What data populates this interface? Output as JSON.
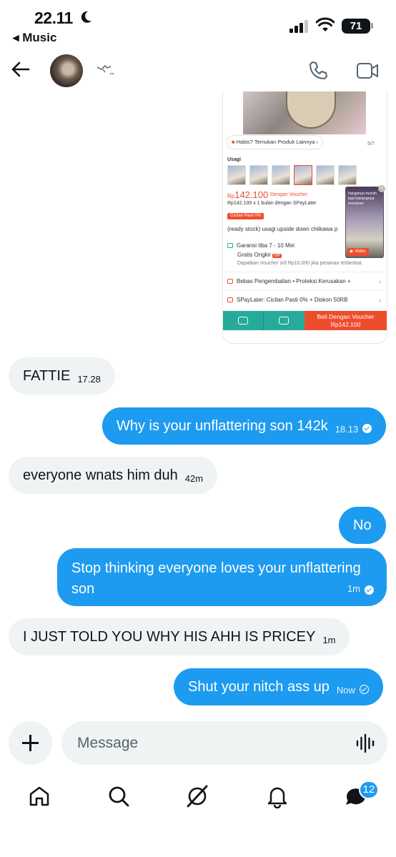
{
  "status_bar": {
    "time": "22.11",
    "back_app": "◂ Music",
    "battery": "71"
  },
  "header": {
    "back_label": "Back",
    "name_glyph": "„"
  },
  "shared_product": {
    "find_more": "Habis? Temukan Produk Lainnya",
    "counter": "5/7",
    "variant_label": "Usagi",
    "price_prefix": "Rp",
    "price": "142.100",
    "voucher": "Dengan Voucher",
    "spaylater": "Rp142.100 x 1 bulan dengan SPayLater",
    "cicilan": "Cicilan Pasti 0%",
    "title": "(ready stock) usagi upside down chiikawa p",
    "shipping_line1": "Garansi tiba 7 - 10 Mei",
    "shipping_line2": "Gratis Ongkir",
    "vip": "VIP",
    "shipping_note": "Dapatkan Voucher s/d Rp10.000 jika pesanan terlambat.",
    "returns": "Bebas Pengembalian  •  Proteksi Kerusakan +",
    "spay_offer": "SPayLater: Cicilan Pasti 0% + Diskon 50RB",
    "video_caption": "harganya murah tapi barangnya murahan",
    "video_button": "▶ Video",
    "buy_line1": "Beli Dengan Voucher",
    "buy_line2": "Rp142.100"
  },
  "messages": [
    {
      "text": "FATTIE",
      "time": "17.28"
    },
    {
      "text": "Why is your unflattering son 142k",
      "time": "18.13"
    },
    {
      "text": "everyone wnats him duh",
      "time": "42m"
    },
    {
      "text": "No",
      "time": ""
    },
    {
      "text": "Stop thinking everyone loves your unflattering son",
      "time": "1m"
    },
    {
      "text": "I JUST TOLD YOU WHY HIS AHH IS PRICEY",
      "time": "1m"
    },
    {
      "text": "Shut your nitch ass up",
      "time": "Now"
    }
  ],
  "composer": {
    "placeholder": "Message"
  },
  "nav": {
    "messages_badge": "12"
  },
  "colors": {
    "accent": "#1d9bf0",
    "bubble_in": "#eff3f4",
    "shopee_orange": "#ee4d2d",
    "shopee_green": "#26aa99"
  }
}
